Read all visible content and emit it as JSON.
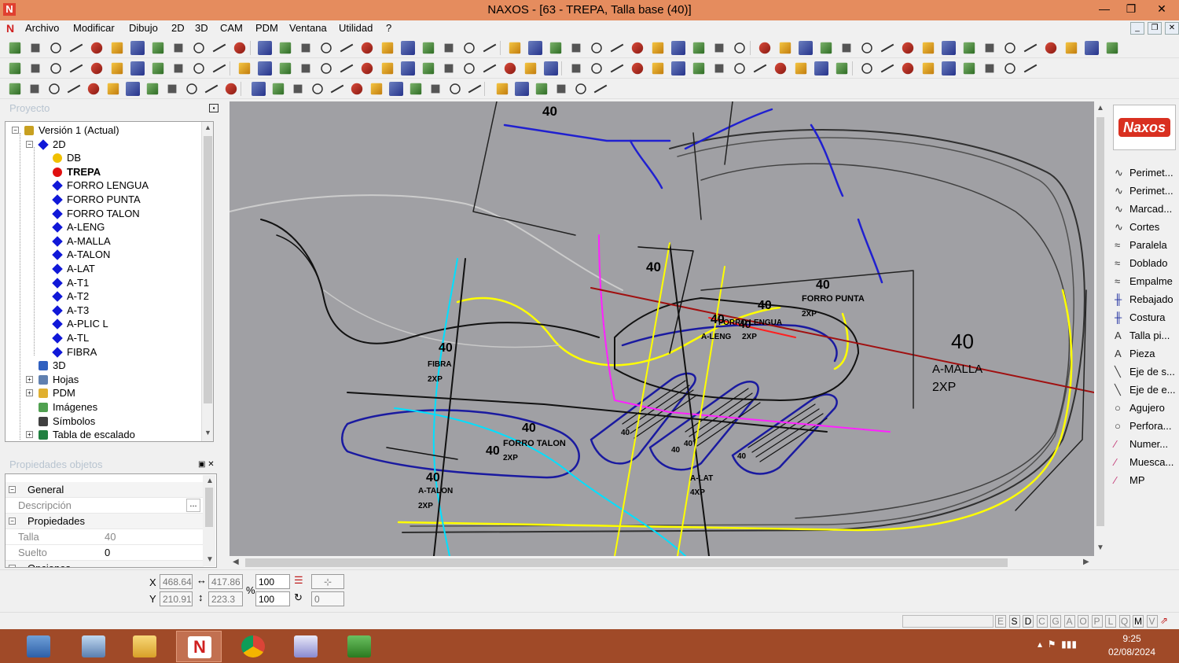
{
  "window": {
    "title": "NAXOS - [63 - TREPA, Talla base (40)]",
    "app_icon": "N"
  },
  "window_controls": [
    "—",
    "❐",
    "✕"
  ],
  "mdi_controls": [
    "_",
    "❐",
    "✕"
  ],
  "menu": [
    "Archivo",
    "Modificar",
    "Dibujo",
    "2D",
    "3D",
    "CAM",
    "PDM",
    "Ventana",
    "Utilidad",
    "?"
  ],
  "project_panel": {
    "title": "Proyecto",
    "tree": [
      {
        "label": "Versión 1 (Actual)",
        "level": 0,
        "icon": "version-icon"
      },
      {
        "label": "2D",
        "level": 1,
        "icon": "diamond-icon"
      },
      {
        "label": "DB",
        "level": 2,
        "icon": "yellow-dot-icon"
      },
      {
        "label": "TREPA",
        "level": 2,
        "icon": "red-dot-icon",
        "bold": true
      },
      {
        "label": "FORRO LENGUA",
        "level": 2,
        "icon": "diamond-icon"
      },
      {
        "label": "FORRO PUNTA",
        "level": 2,
        "icon": "diamond-icon"
      },
      {
        "label": "FORRO TALON",
        "level": 2,
        "icon": "diamond-icon"
      },
      {
        "label": "A-LENG",
        "level": 2,
        "icon": "diamond-icon"
      },
      {
        "label": "A-MALLA",
        "level": 2,
        "icon": "diamond-icon"
      },
      {
        "label": "A-TALON",
        "level": 2,
        "icon": "diamond-icon"
      },
      {
        "label": "A-LAT",
        "level": 2,
        "icon": "diamond-icon"
      },
      {
        "label": "A-T1",
        "level": 2,
        "icon": "diamond-icon"
      },
      {
        "label": "A-T2",
        "level": 2,
        "icon": "diamond-icon"
      },
      {
        "label": "A-T3",
        "level": 2,
        "icon": "diamond-icon"
      },
      {
        "label": "A-PLIC L",
        "level": 2,
        "icon": "diamond-icon"
      },
      {
        "label": "A-TL",
        "level": 2,
        "icon": "diamond-icon"
      },
      {
        "label": "FIBRA",
        "level": 2,
        "icon": "diamond-icon"
      },
      {
        "label": "3D",
        "level": 1,
        "icon": "3d-icon"
      },
      {
        "label": "Hojas",
        "level": 1,
        "icon": "sheets-icon"
      },
      {
        "label": "PDM",
        "level": 1,
        "icon": "folder-icon"
      },
      {
        "label": "Imágenes",
        "level": 1,
        "icon": "images-icon"
      },
      {
        "label": "Símbolos",
        "level": 1,
        "icon": "symbols-icon"
      },
      {
        "label": "Tabla de escalado",
        "level": 1,
        "icon": "scale-table-icon"
      }
    ]
  },
  "properties_panel": {
    "title": "Propiedades objetos",
    "rows": [
      {
        "type": "group",
        "label": "General"
      },
      {
        "type": "field",
        "label": "Descripción",
        "value": "",
        "button": "..."
      },
      {
        "type": "group",
        "label": "Propiedades"
      },
      {
        "type": "field",
        "label": "Talla",
        "value": "40"
      },
      {
        "type": "field",
        "label": "Suelto",
        "value": "0"
      },
      {
        "type": "group",
        "label": "Opciones"
      }
    ]
  },
  "right_tools": {
    "logo": "Naxos",
    "items": [
      "Perimet...",
      "Perimet...",
      "Marcad...",
      "Cortes",
      "Paralela",
      "Doblado",
      "Empalme",
      "Rebajado",
      "Costura",
      "Talla pi...",
      "Pieza",
      "Eje de s...",
      "Eje de e...",
      "Agujero",
      "Perfora...",
      "Numer...",
      "Muesca...",
      "MP"
    ],
    "icons": [
      "∿",
      "∿",
      "∿",
      "∿",
      "≈",
      "≈",
      "≈",
      "╫",
      "╫",
      "A",
      "A",
      "╲",
      "╲",
      "○",
      "○",
      "⁄",
      "⁄",
      "⁄"
    ]
  },
  "canvas_labels": [
    {
      "text": "40"
    },
    {
      "text": "40"
    },
    {
      "text": "40"
    },
    {
      "text": "FORRO PUNTA"
    },
    {
      "text": "40"
    },
    {
      "text": "2XP"
    },
    {
      "text": "40"
    },
    {
      "text": "FORRO LENGUA"
    },
    {
      "text": "40"
    },
    {
      "text": "A-LENG"
    },
    {
      "text": "2XP"
    },
    {
      "text": "40"
    },
    {
      "text": "A-MALLA"
    },
    {
      "text": "2XP"
    },
    {
      "text": "40"
    },
    {
      "text": "FIBRA"
    },
    {
      "text": "2XP"
    },
    {
      "text": "40"
    },
    {
      "text": "40"
    },
    {
      "text": "FORRO TALON"
    },
    {
      "text": "2XP"
    },
    {
      "text": "40"
    },
    {
      "text": "A-TALON"
    },
    {
      "text": "2XP"
    },
    {
      "text": "40"
    },
    {
      "text": "40"
    },
    {
      "text": "A-LAT"
    },
    {
      "text": "4XP"
    },
    {
      "text": "40"
    },
    {
      "text": "40"
    }
  ],
  "coords": {
    "x_label": "X",
    "y_label": "Y",
    "x": "468.64",
    "y": "210.91",
    "width": "417.86",
    "height": "223.3",
    "scale_x": "100",
    "scale_y": "100",
    "percent": "%",
    "rotation": "0"
  },
  "status_keys": [
    "E",
    "S",
    "D",
    "C",
    "G",
    "A",
    "O",
    "P",
    "L",
    "Q",
    "M",
    "V"
  ],
  "taskbar": {
    "time": "9:25",
    "date": "02/08/2024"
  },
  "colors": {
    "titlebar": "#e58c5e",
    "canvas": "#a0a0a4",
    "taskbar": "#a04a28",
    "accent_red": "#d93020"
  }
}
